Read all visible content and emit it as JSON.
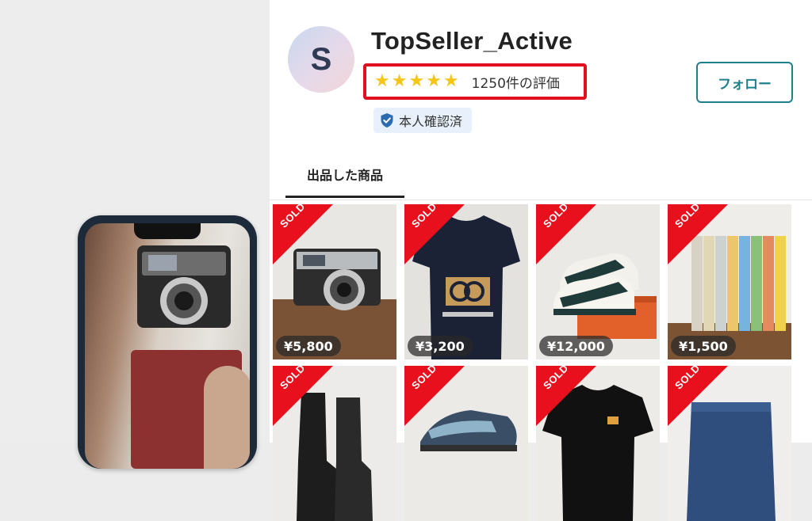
{
  "seller": {
    "avatar_letter": "S",
    "name": "TopSeller_Active",
    "rating_stars": 5,
    "review_count": "1250件の評価",
    "verified_label": "本人確認済",
    "follow_label": "フォロー"
  },
  "tabs": [
    {
      "label": "出品した商品",
      "active": true
    }
  ],
  "sold_label": "SOLD",
  "items": [
    {
      "price": "¥5,800",
      "icon": "film-camera",
      "sold": true
    },
    {
      "price": "¥3,200",
      "icon": "navy-tshirt",
      "sold": true
    },
    {
      "price": "¥12,000",
      "icon": "sneakers",
      "sold": true
    },
    {
      "price": "¥1,500",
      "icon": "book-set",
      "sold": true
    },
    {
      "price": "",
      "icon": "leather-boots",
      "sold": true
    },
    {
      "price": "",
      "icon": "running-shoes",
      "sold": true
    },
    {
      "price": "",
      "icon": "black-tshirt",
      "sold": true
    },
    {
      "price": "",
      "icon": "denim-shorts",
      "sold": true
    }
  ],
  "colors": {
    "accent": "#1f7f8a",
    "highlight_border": "#e0101f",
    "sold_ribbon": "#e8101c",
    "star": "#f5c518"
  }
}
